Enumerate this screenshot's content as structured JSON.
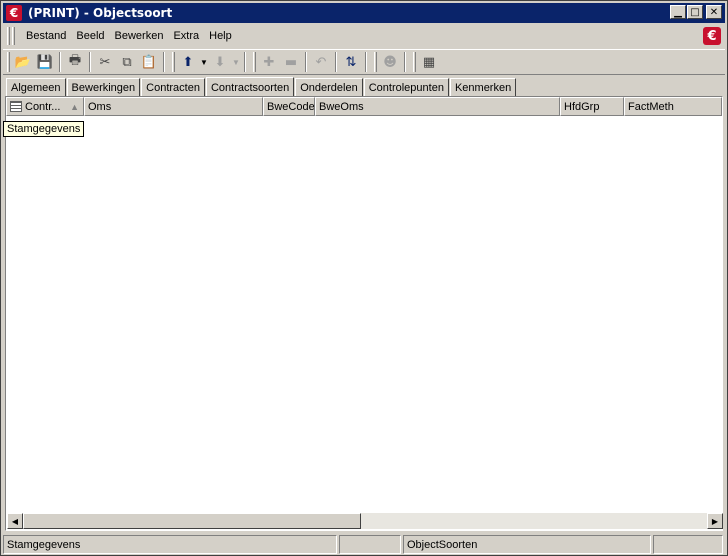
{
  "window": {
    "app_icon": "eplus-logo-icon",
    "title": "(PRINT) - Objectsoort",
    "buttons": [
      "minimize-icon",
      "maximize-icon",
      "close-icon"
    ]
  },
  "menu": {
    "items": [
      {
        "label": "Bestand"
      },
      {
        "label": "Beeld"
      },
      {
        "label": "Bewerken"
      },
      {
        "label": "Extra"
      },
      {
        "label": "Help"
      }
    ],
    "brand_icon": "eplus-logo-icon"
  },
  "toolbar": {
    "buttons": [
      "open-icon",
      "save-icon",
      "print-icon",
      "cut-icon",
      "copy-icon",
      "paste-icon",
      "arrow-up-icon",
      "arrow-down-icon",
      "add-icon",
      "remove-icon",
      "undo-icon",
      "refresh-icon",
      "user-icon",
      "layout-icon"
    ]
  },
  "tabs": [
    {
      "label": "Algemeen",
      "active": false
    },
    {
      "label": "Bewerkingen",
      "active": false
    },
    {
      "label": "Contracten",
      "active": false
    },
    {
      "label": "Contractsoorten",
      "active": true
    },
    {
      "label": "Onderdelen",
      "active": false
    },
    {
      "label": "Controlepunten",
      "active": false
    },
    {
      "label": "Kenmerken",
      "active": false
    }
  ],
  "grid": {
    "columns": [
      {
        "label": "Contr...",
        "sorted": true
      },
      {
        "label": "Oms"
      },
      {
        "label": "BweCode"
      },
      {
        "label": "BweOms"
      },
      {
        "label": "HfdGrp"
      },
      {
        "label": "FactMeth"
      }
    ],
    "tooltip": "Stamgegevens"
  },
  "status": {
    "pane1": "Stamgegevens",
    "pane2": "",
    "pane3": "ObjectSoorten",
    "pane4": ""
  }
}
